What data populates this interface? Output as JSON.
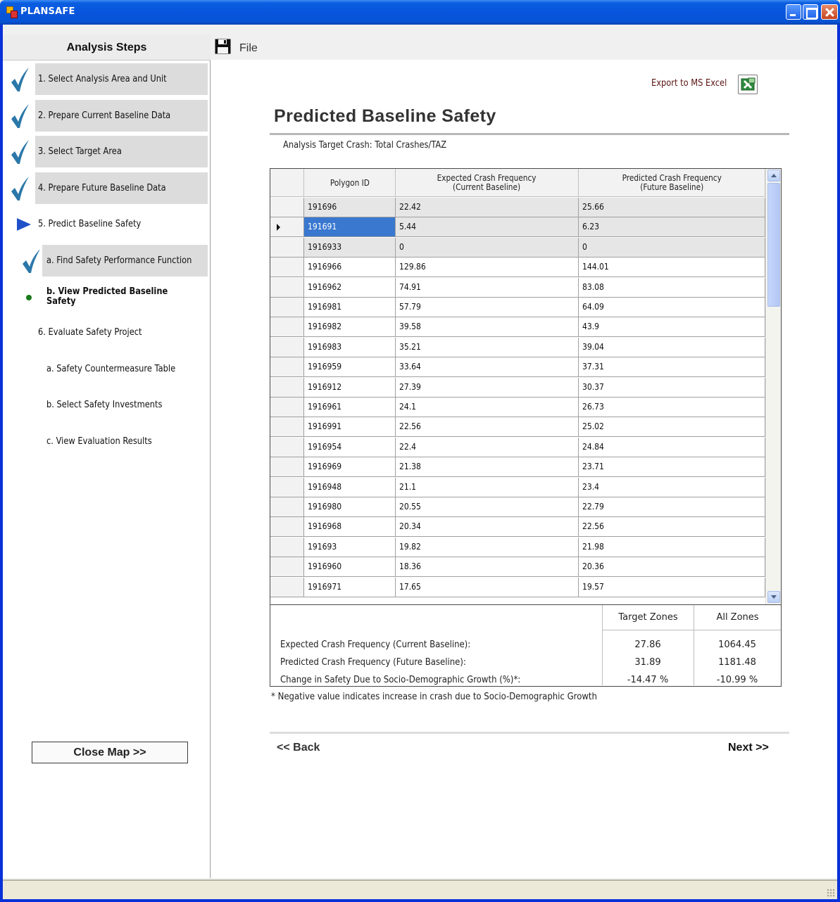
{
  "window": {
    "title": "PLANSAFE"
  },
  "sidebar": {
    "header": "Analysis Steps",
    "steps": [
      {
        "label": "1. Select Analysis Area and Unit",
        "status": "done"
      },
      {
        "label": "2. Prepare Current Baseline Data",
        "status": "done"
      },
      {
        "label": "3. Select Target Area",
        "status": "done"
      },
      {
        "label": "4. Prepare Future Baseline Data",
        "status": "done"
      },
      {
        "label": "5. Predict Baseline Safety",
        "status": "current"
      },
      {
        "label": "a. Find Safety Performance Function",
        "status": "done"
      },
      {
        "label": "b. View Predicted Baseline Safety",
        "status": "active"
      },
      {
        "label": "6. Evaluate Safety Project",
        "status": "pending"
      },
      {
        "label": "a. Safety Countermeasure Table",
        "status": "pending"
      },
      {
        "label": "b. Select Safety Investments",
        "status": "pending"
      },
      {
        "label": "c. View Evaluation Results",
        "status": "pending"
      }
    ],
    "close_map_label": "Close Map >>"
  },
  "menu": {
    "file_label": "File"
  },
  "main": {
    "export_label": "Export to MS Excel",
    "page_title": "Predicted Baseline Safety",
    "target_crash": "Analysis Target Crash: Total Crashes/TAZ",
    "grid": {
      "headers": [
        "Polygon ID",
        "Expected Crash Frequency\n(Current Baseline)",
        "Predicted Crash Frequency\n(Future Baseline)"
      ],
      "selected_row": 1,
      "rows": [
        [
          "191696",
          "22.42",
          "25.66"
        ],
        [
          "191691",
          "5.44",
          "6.23"
        ],
        [
          "1916933",
          "0",
          "0"
        ],
        [
          "1916966",
          "129.86",
          "144.01"
        ],
        [
          "1916962",
          "74.91",
          "83.08"
        ],
        [
          "1916981",
          "57.79",
          "64.09"
        ],
        [
          "1916982",
          "39.58",
          "43.9"
        ],
        [
          "1916983",
          "35.21",
          "39.04"
        ],
        [
          "1916959",
          "33.64",
          "37.31"
        ],
        [
          "1916912",
          "27.39",
          "30.37"
        ],
        [
          "1916961",
          "24.1",
          "26.73"
        ],
        [
          "1916991",
          "22.56",
          "25.02"
        ],
        [
          "1916954",
          "22.4",
          "24.84"
        ],
        [
          "1916969",
          "21.38",
          "23.71"
        ],
        [
          "1916948",
          "21.1",
          "23.4"
        ],
        [
          "1916980",
          "20.55",
          "22.79"
        ],
        [
          "1916968",
          "20.34",
          "22.56"
        ],
        [
          "191693",
          "19.82",
          "21.98"
        ],
        [
          "1916960",
          "18.36",
          "20.36"
        ],
        [
          "1916971",
          "17.65",
          "19.57"
        ]
      ]
    },
    "summary": {
      "col_target": "Target Zones",
      "col_all": "All Zones",
      "rows": [
        {
          "label": "Expected Crash Frequency (Current Baseline):",
          "target": "27.86",
          "all": "1064.45"
        },
        {
          "label": "Predicted Crash Frequency (Future Baseline):",
          "target": "31.89",
          "all": "1181.48"
        },
        {
          "label": "Change in Safety Due to Socio-Demographic Growth (%)*:",
          "target": "-14.47 %",
          "all": "-10.99 %"
        }
      ]
    },
    "note": "* Negative value indicates increase in crash due to Socio-Demographic Growth",
    "back_label": "<< Back",
    "next_label": "Next >>"
  },
  "colors": {
    "accent": "#3a78d0",
    "title_bar": "#0855dd",
    "check": "#2a77a8",
    "export_text": "#5a1414"
  }
}
